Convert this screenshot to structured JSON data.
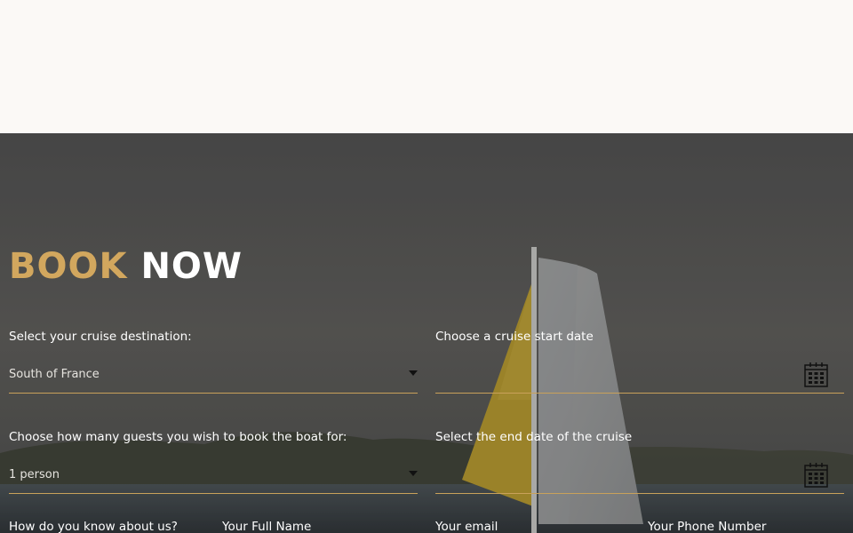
{
  "booking": {
    "heading_word1": "BOOK",
    "heading_word2": "NOW",
    "accent_color": "#d2a75e",
    "destination": {
      "label": "Select your cruise destination:",
      "value": "South of France"
    },
    "start_date": {
      "label": "Choose a cruise start date",
      "value": ""
    },
    "guests": {
      "label": "Choose how many guests you wish to book the boat for:",
      "value": "1 person"
    },
    "end_date": {
      "label": "Select the end date of the cruise",
      "value": ""
    },
    "referral": {
      "label": "How do you know about us?"
    },
    "full_name": {
      "label": "Your Full Name"
    },
    "email": {
      "label": "Your email"
    },
    "phone": {
      "label": "Your Phone Number"
    }
  },
  "icons": {
    "select_caret": "caret-down-icon",
    "date_picker": "calendar-icon"
  }
}
